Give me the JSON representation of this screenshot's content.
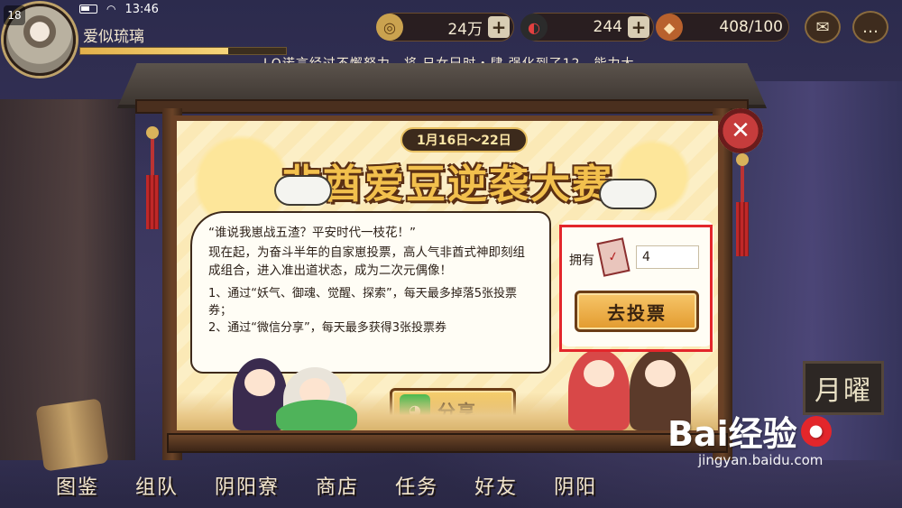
{
  "status_bar": {
    "level": "18",
    "time": "13:46"
  },
  "player": {
    "name": "爱似琉璃",
    "exp_fraction": 0.72
  },
  "currency": {
    "coins": "24万",
    "jade": "244",
    "stamina": "408/100"
  },
  "news_ticker": "LQ诺言经过不懈努力，将 日女巳时・肆 强化到了12，能力大",
  "event": {
    "date_range": "1月16日～22日",
    "title": "非酋爱豆逆袭大赛",
    "description_quote": "“谁说我崽战五渣？平安时代一枝花！”",
    "description_body": "现在起，为奋斗半年的自家崽投票，高人气非酋式神即刻组成组合，进入准出道状态，成为二次元偶像！",
    "rule_1": "1、通过“妖气、御魂、觉醒、探索”，每天最多掉落5张投票券；",
    "rule_2": "2、通过“微信分享”，每天最多获得3张投票券",
    "own_label": "拥有",
    "ticket_count": "4",
    "vote_button": "去投票",
    "share_button": "分享"
  },
  "bottom_nav": [
    "图鉴",
    "组队",
    "阴阳寮",
    "商店",
    "任务",
    "好友",
    "阴阳"
  ],
  "scene_sign": "月曜",
  "watermark": {
    "brand": "Bai经验",
    "url": "jingyan.baidu.com"
  },
  "colors": {
    "highlight": "#e3262b",
    "accent_gold": "#f2c04d",
    "board_bg": "#fcf1d0"
  },
  "icons": {
    "coin": "coin-icon",
    "jade": "jade-icon",
    "stamina": "stamina-icon",
    "mail": "mail-icon",
    "chat": "chat-icon",
    "close": "close-icon",
    "wechat": "wechat-icon",
    "ticket": "ticket-icon"
  }
}
